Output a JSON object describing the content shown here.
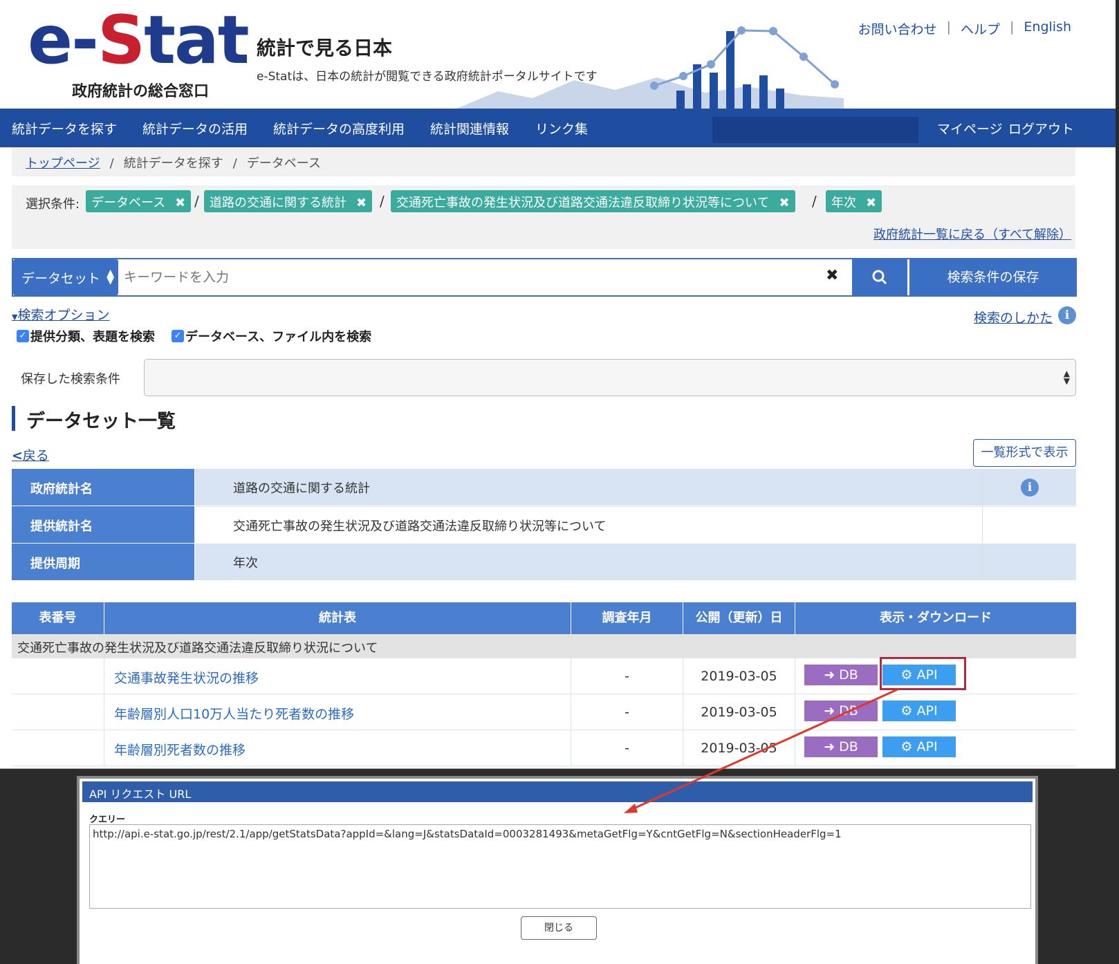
{
  "header": {
    "logo_main_left": "e-",
    "logo_main_s": "S",
    "logo_main_right": "tat",
    "logo_sub": "政府統計の総合窓口",
    "title": "統計で見る日本",
    "tagline": "e-Statは、日本の統計が閲覧できる政府統計ポータルサイトです",
    "links": [
      "お問い合わせ",
      "ヘルプ",
      "English"
    ],
    "link_sep": "|"
  },
  "nav": {
    "items": [
      "統計データを探す",
      "統計データの活用",
      "統計データの高度利用",
      "統計関連情報",
      "リンク集"
    ],
    "mypage": "マイページ",
    "logout": "ログアウト"
  },
  "breadcrumb": [
    "トップページ",
    "統計データを探す",
    "データベース"
  ],
  "conditions": {
    "label": "選択条件:",
    "chips": [
      "データベース",
      "道路の交通に関する統計",
      "交通死亡事故の発生状況及び道路交通法違反取締り状況等について",
      "年次"
    ],
    "remove_glyph": "✖",
    "separator": "/",
    "reset_link": "政府統計一覧に戻る（すべて解除）"
  },
  "search": {
    "type": "データセット",
    "placeholder": "キーワードを入力",
    "clear_glyph": "✖",
    "save_label": "検索条件の保存",
    "options_link": "検索オプション",
    "howto_link": "検索のしかた",
    "checkbox1": "提供分類、表題を検索",
    "checkbox2": "データベース、ファイル内を検索",
    "checked_glyph": "✓",
    "saved_label": "保存した検索条件"
  },
  "section": {
    "title": "データセット一覧",
    "back": "戻る",
    "list_view": "一覧形式で表示"
  },
  "info": [
    {
      "label": "政府統計名",
      "value": "道路の交通に関する統計"
    },
    {
      "label": "提供統計名",
      "value": "交通死亡事故の発生状況及び道路交通法違反取締り状況等について"
    },
    {
      "label": "提供周期",
      "value": "年次"
    }
  ],
  "info_icon": "i",
  "stats_table": {
    "headers": [
      "表番号",
      "統計表",
      "調査年月",
      "公開（更新）日",
      "表示・ダウンロード"
    ],
    "group": "交通死亡事故の発生状況及び道路交通法違反取締り状況について",
    "rows": [
      {
        "title": "交通事故発生状況の推移",
        "survey": "-",
        "date": "2019-03-05"
      },
      {
        "title": "年齢層別人口10万人当たり死者数の推移",
        "survey": "-",
        "date": "2019-03-05"
      },
      {
        "title": "年齢層別死者数の推移",
        "survey": "-",
        "date": "2019-03-05"
      }
    ],
    "db_label": "➜ DB",
    "api_label": "⚙ API"
  },
  "modal": {
    "title": "API リクエスト URL",
    "query_label": "クエリー",
    "url": "http://api.e-stat.go.jp/rest/2.1/app/getStatsData?appId=&lang=J&statsDataId=0003281493&metaGetFlg=Y&cntGetFlg=N&sectionHeaderFlg=1",
    "close": "閉じる"
  },
  "colors": {
    "brand_blue": "#1f4ea0",
    "brand_red": "#c8202f",
    "chip_teal": "#3bab9e",
    "db_purple": "#9b6dc2",
    "api_blue": "#3c9ef0",
    "highlight": "#b02a45",
    "annotation_arrow": "#e0372b"
  }
}
